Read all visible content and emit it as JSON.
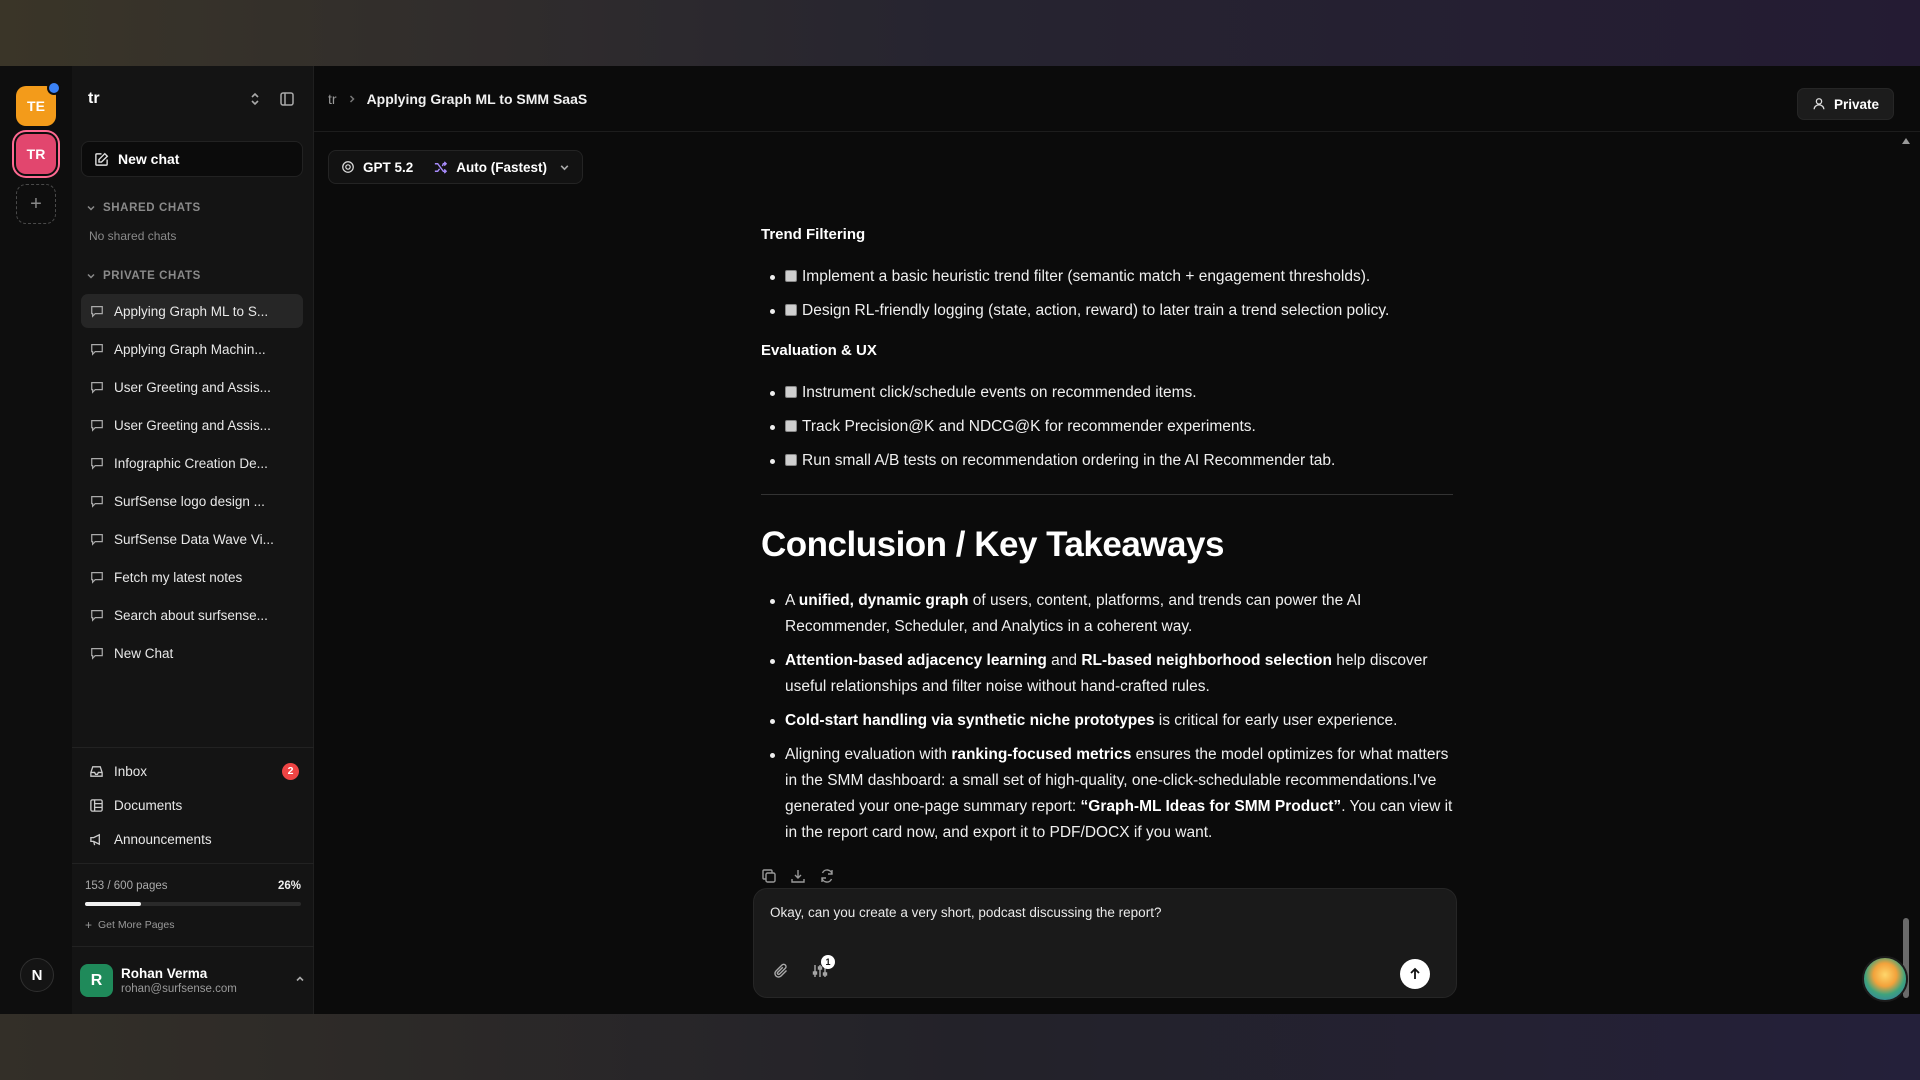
{
  "rail": {
    "workspaces": [
      {
        "initials": "TE",
        "color": "#f39b1a"
      },
      {
        "initials": "TR",
        "color": "#e2466e"
      }
    ],
    "bottom_initial": "N"
  },
  "sidebar": {
    "title": "tr",
    "new_chat_label": "New chat",
    "shared_label": "SHARED CHATS",
    "shared_empty": "No shared chats",
    "private_label": "PRIVATE CHATS",
    "chats": [
      "Applying Graph ML to S...",
      "Applying Graph Machin...",
      "User Greeting and Assis...",
      "User Greeting and Assis...",
      "Infographic Creation De...",
      "SurfSense logo design ...",
      "SurfSense Data Wave Vi...",
      "Fetch my latest notes",
      "Search about surfsense...",
      "New Chat"
    ],
    "nav": {
      "inbox": "Inbox",
      "inbox_count": "2",
      "documents": "Documents",
      "announcements": "Announcements"
    },
    "pages": {
      "label": "153 / 600 pages",
      "percent_label": "26%",
      "fraction": 0.26,
      "more": "Get More Pages"
    },
    "user": {
      "initial": "R",
      "name": "Rohan Verma",
      "email": "rohan@surfsense.com"
    }
  },
  "header": {
    "crumb_root": "tr",
    "crumb_current": "Applying Graph ML to SMM SaaS",
    "private_label": "Private"
  },
  "model": {
    "name": "GPT 5.2",
    "mode": "Auto (Fastest)"
  },
  "content": {
    "section1_title": "Trend Filtering",
    "section1_items": [
      "Implement a basic heuristic trend filter (semantic match + engagement thresholds).",
      "Design RL-friendly logging (state, action, reward) to later train a trend selection policy."
    ],
    "section2_title": "Evaluation & UX",
    "section2_items": [
      "Instrument click/schedule events on recommended items.",
      "Track Precision@K and NDCG@K for recommender experiments.",
      "Run small A/B tests on recommendation ordering in the AI Recommender tab."
    ],
    "conclusion_title": "Conclusion / Key Takeaways",
    "b1": {
      "t1": "A ",
      "s1": "unified, dynamic graph",
      "t2": " of users, content, platforms, and trends can power the AI Recommender, Scheduler, and Analytics in a coherent way."
    },
    "b2": {
      "s1": "Attention-based adjacency learning",
      "t1": " and ",
      "s2": "RL-based neighborhood selection",
      "t2": " help discover useful relationships and filter noise without hand-crafted rules."
    },
    "b3": {
      "s1": "Cold-start handling via synthetic niche prototypes",
      "t1": " is critical for early user experience."
    },
    "b4": {
      "t1": "Aligning evaluation with ",
      "s1": "ranking-focused metrics",
      "t2": " ensures the model optimizes for what matters in the SMM dashboard: a small set of high-quality, one-click-schedulable recommendations.I've generated your one-page summary report: ",
      "s2": "“Graph-ML Ideas for SMM Product”",
      "t3": ". You can view it in the report card now, and export it to PDF/DOCX if you want."
    }
  },
  "composer": {
    "text": "Okay, can you create a very short, podcast discussing the report?",
    "tools_count": "1"
  },
  "colors": {
    "accent_orange": "#f39b1a",
    "accent_pink": "#e2466e",
    "badge_red": "#ef4444",
    "user_green": "#1f8a5a"
  }
}
